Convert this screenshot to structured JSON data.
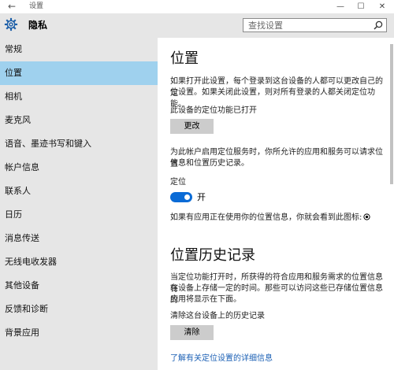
{
  "window": {
    "title": "设置",
    "back_glyph": "←",
    "minimize_glyph": "—",
    "maximize_glyph": "☐",
    "close_glyph": "✕"
  },
  "header": {
    "icon": "gear-icon",
    "title": "隐私",
    "search_placeholder": "查找设置",
    "search_icon": "search-icon"
  },
  "sidebar": {
    "selected_index": 1,
    "items": [
      {
        "label": "常规"
      },
      {
        "label": "位置"
      },
      {
        "label": "相机"
      },
      {
        "label": "麦克风"
      },
      {
        "label": "语音、墨迹书写和键入"
      },
      {
        "label": "帐户信息"
      },
      {
        "label": "联系人"
      },
      {
        "label": "日历"
      },
      {
        "label": "消息传送"
      },
      {
        "label": "无线电收发器"
      },
      {
        "label": "其他设备"
      },
      {
        "label": "反馈和诊断"
      },
      {
        "label": "背景应用"
      }
    ]
  },
  "main": {
    "location_heading": "位置",
    "location_desc_1": "如果打开此设置，每个登录到这台设备的人都可以更改自己的定",
    "location_desc_2": "位设置。如果关闭此设置，则对所有登录的人都关闭定位功能。",
    "device_status": "此设备的定位功能已打开",
    "change_button": "更改",
    "account_desc_1": "为此帐户启用定位服务时，你所允许的应用和服务可以请求位置",
    "account_desc_2": "信息和位置历史记录。",
    "toggle_label": "定位",
    "toggle_state": "开",
    "toggle_on": true,
    "icon_notice": "如果有应用正在使用你的位置信息，你就会看到此图标:",
    "history_heading": "位置历史记录",
    "history_desc_1": "当定位功能打开时，所获得的符合应用和服务需求的位置信息将",
    "history_desc_2": "在设备上存储一定的时间。那些可以访问这些已存储位置信息的",
    "history_desc_3": "应用将显示在下面。",
    "clear_label": "清除这台设备上的历史记录",
    "clear_button": "清除",
    "more_link": "了解有关定位设置的详细信息"
  },
  "colors": {
    "sidebar_bg": "#e6e6e6",
    "selected_bg": "#9fd1ee",
    "accent": "#0a6bd6",
    "link": "#1a5fb4",
    "button_bg": "#cccccc"
  }
}
